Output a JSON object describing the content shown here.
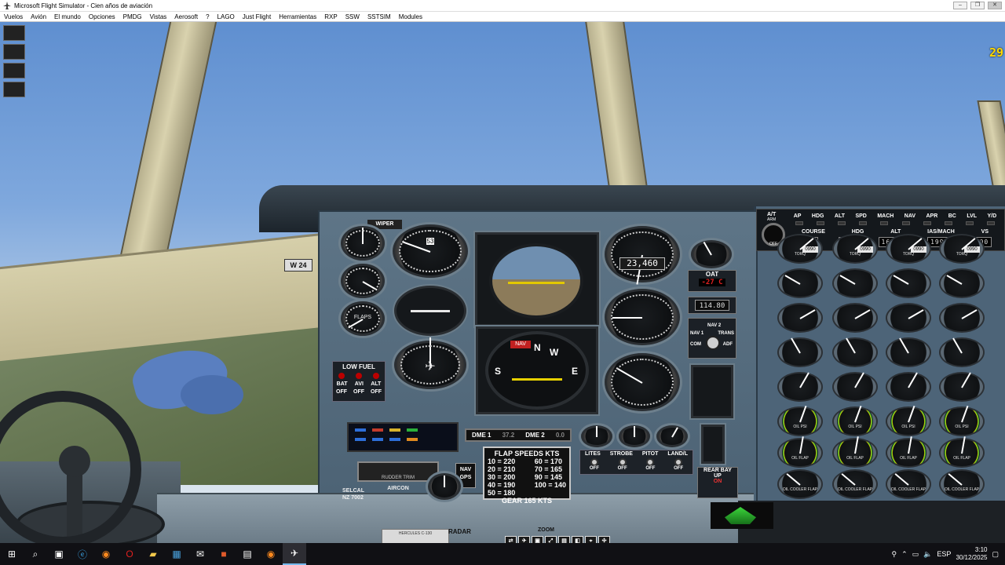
{
  "window": {
    "title": "Microsoft Flight Simulator - Cien años de aviación",
    "buttons": [
      "–",
      "❐",
      "✕"
    ]
  },
  "menubar": {
    "items": [
      "Vuelos",
      "Avión",
      "El mundo",
      "Opciones",
      "PMDG",
      "Vistas",
      "Aerosoft",
      "?",
      "LAGO",
      "Just Flight",
      "Herramientas",
      "RXP",
      "SSW",
      "SSTSIM",
      "Modules"
    ]
  },
  "hud": {
    "frame_rate": "29"
  },
  "cockpit": {
    "compass_heading": "W 24",
    "wiper_label": "WIPER",
    "altimeter_readout": "23,460",
    "airspeed_mini": "53",
    "hsi_flag": "NAV",
    "hsi_cardinals": [
      "N",
      "E",
      "S",
      "W"
    ],
    "low_fuel": {
      "title": "LOW FUEL",
      "switches": [
        "BAT",
        "AVI",
        "ALT"
      ],
      "states": [
        "OFF",
        "OFF",
        "OFF"
      ]
    },
    "dme": {
      "dme1_label": "DME 1",
      "dme1_value": "37.2",
      "dme2_label": "DME 2",
      "dme2_value": "0.0"
    },
    "flap_speeds": {
      "title": "FLAP SPEEDS KTS",
      "left": [
        "10 = 220",
        "20 = 210",
        "30 = 200",
        "40 = 190",
        "50 = 180"
      ],
      "right": [
        "60 = 170",
        "70 = 165",
        "90 = 145",
        "100 = 140"
      ],
      "footer": "GEAR 165 KTS"
    },
    "lites": {
      "headers": [
        "LITES",
        "STROBE",
        "PITOT",
        "LAND/L"
      ],
      "states": [
        "OFF",
        "OFF",
        "OFF",
        "OFF"
      ]
    },
    "rear_bay": {
      "title": "REAR BAY",
      "up": "UP",
      "on": "ON"
    },
    "oat": {
      "label": "OAT",
      "value": "-27 C"
    },
    "nav_freq": "114.80",
    "nav_selector": {
      "nav1": "NAV 1",
      "nav2": "NAV 2",
      "trans": "TRANS",
      "adf": "ADF",
      "com": "COM"
    },
    "rudder_trim": "RUDDER TRIM",
    "nav_gps": {
      "line1": "NAV",
      "line2": "GPS"
    },
    "selcal": {
      "line1": "SELCAL",
      "line2": "NZ 7002"
    },
    "aircon": "AIRCON",
    "radar": "RADAR",
    "zoom": "ZOOM",
    "hercules_plate": "HERCULES C-130"
  },
  "autopilot": {
    "at_arm": "A/T",
    "at_sub": "ARM",
    "off_label": "OFF",
    "modes": [
      "AP",
      "HDG",
      "ALT",
      "SPD",
      "MACH",
      "NAV",
      "APR",
      "BC",
      "LVL",
      "Y/D"
    ],
    "selectors": [
      "COURSE",
      "HDG",
      "ALT",
      "IAS/MACH",
      "VS"
    ],
    "values": [
      "340",
      "340",
      "16000",
      "199",
      "0000"
    ]
  },
  "engine_gauges": {
    "row1": [
      "TORQ",
      "TORQ",
      "TORQ",
      "TORQ"
    ],
    "row1_values": [
      "0990",
      "0990",
      "0990",
      "0990"
    ],
    "row6": [
      "OIL PSI",
      "OIL PSI",
      "OIL PSI",
      "OIL PSI"
    ],
    "row7": [
      "OIL FLAP",
      "OIL FLAP",
      "OIL FLAP",
      "OIL FLAP"
    ],
    "row8": [
      "OIL COOLER FLAP",
      "OIL COOLER FLAP",
      "OIL COOLER FLAP",
      "OIL COOLER FLAP"
    ]
  },
  "taskbar": {
    "apps": [
      "windows-start",
      "search",
      "task-view",
      "edge",
      "firefox",
      "opera",
      "file-explorer",
      "photos",
      "mail",
      "store",
      "notepad",
      "firefox-2",
      "flight-sim"
    ],
    "language": "ESP",
    "time": "3:10",
    "date": "30/12/2025"
  },
  "colors": {
    "panel": "#4a6072",
    "hud_yellow": "#ffd800",
    "warning_red": "#c02020"
  }
}
